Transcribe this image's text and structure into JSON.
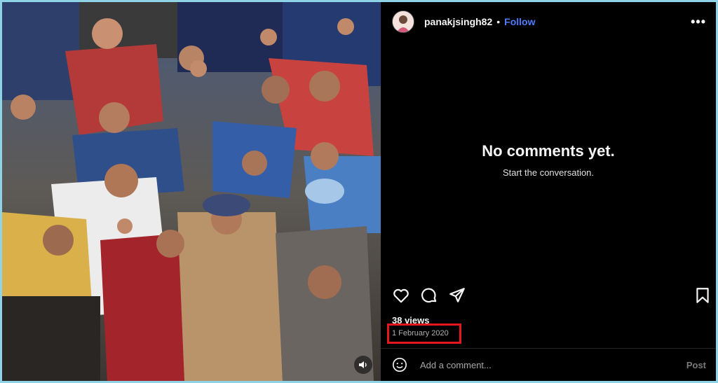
{
  "post": {
    "username": "panakjsingh82",
    "separator": "•",
    "follow_label": "Follow",
    "more_label": "•••"
  },
  "comments": {
    "empty_title": "No comments yet.",
    "empty_subtitle": "Start the conversation."
  },
  "stats": {
    "views": "38 views",
    "date": "1 February 2020"
  },
  "composer": {
    "placeholder": "Add a comment...",
    "post_label": "Post"
  },
  "icons": {
    "like": "heart-icon",
    "comment": "comment-icon",
    "share": "share-icon",
    "save": "bookmark-icon",
    "emoji": "emoji-icon",
    "mute": "speaker-icon"
  },
  "colors": {
    "accent": "#4f7cff",
    "highlight": "#e5161f",
    "frame": "#8fd4e6"
  }
}
